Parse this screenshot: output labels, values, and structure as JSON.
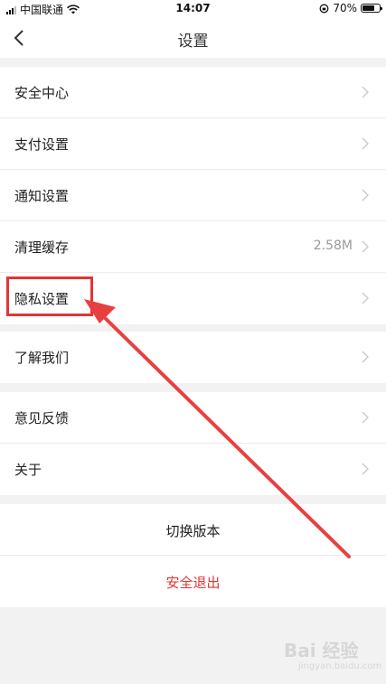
{
  "status_bar": {
    "carrier": "中国联通",
    "time": "14:07",
    "battery": "70%",
    "battery_level": 0.7
  },
  "header": {
    "title": "设置"
  },
  "groups": [
    {
      "items": [
        {
          "label": "安全中心",
          "value": ""
        },
        {
          "label": "支付设置",
          "value": ""
        },
        {
          "label": "通知设置",
          "value": ""
        },
        {
          "label": "清理缓存",
          "value": "2.58M"
        },
        {
          "label": "隐私设置",
          "value": ""
        }
      ]
    },
    {
      "items": [
        {
          "label": "了解我们",
          "value": ""
        }
      ]
    },
    {
      "items": [
        {
          "label": "意见反馈",
          "value": ""
        },
        {
          "label": "关于",
          "value": ""
        }
      ]
    }
  ],
  "actions": {
    "switch_version": "切换版本",
    "logout": "安全退出"
  },
  "colors": {
    "logout": "#e23535",
    "annotation": "#e23535"
  },
  "watermark": {
    "text": "Bai 经验",
    "sub": "jingyan.baidu.com"
  }
}
